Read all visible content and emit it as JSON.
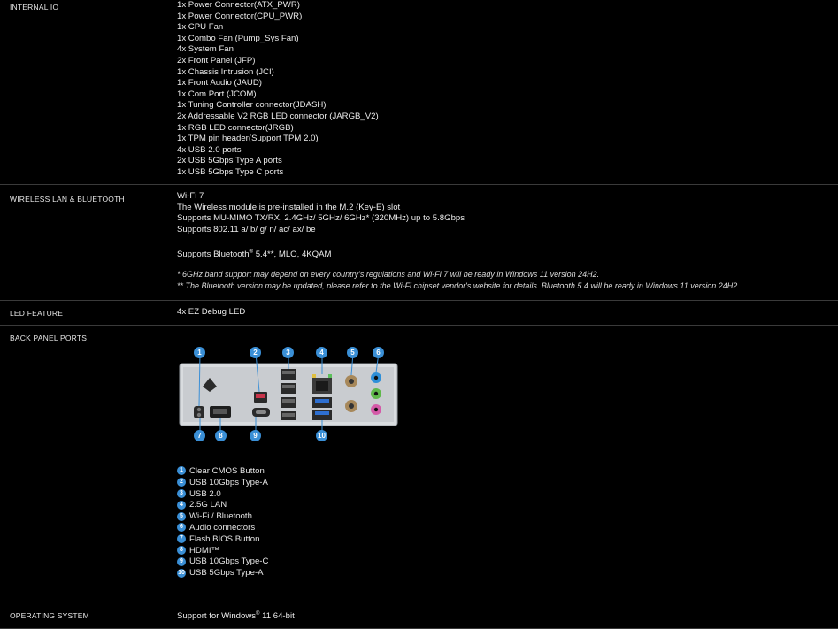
{
  "internal_io": {
    "label": "INTERNAL IO",
    "items": [
      "1x Power Connector(ATX_PWR)",
      "1x Power Connector(CPU_PWR)",
      "1x CPU Fan",
      "1x Combo Fan (Pump_Sys Fan)",
      "4x System Fan",
      "2x Front Panel (JFP)",
      "1x Chassis Intrusion (JCI)",
      "1x Front Audio (JAUD)",
      "1x Com Port (JCOM)",
      "1x Tuning Controller connector(JDASH)",
      "2x Addressable V2 RGB LED connector (JARGB_V2)",
      "1x RGB LED connector(JRGB)",
      "1x TPM pin header(Support TPM 2.0)",
      "4x USB 2.0 ports",
      "2x USB 5Gbps Type A ports",
      "1x USB 5Gbps Type C ports"
    ]
  },
  "wireless": {
    "label": "WIRELESS LAN & BLUETOOTH",
    "lines": [
      "Wi-Fi 7",
      "The Wireless module is pre-installed in the M.2 (Key-E) slot",
      "Supports MU-MIMO TX/RX, 2.4GHz/ 5GHz/ 6GHz* (320MHz) up to 5.8Gbps",
      "Supports 802.11 a/ b/ g/ n/ ac/ ax/ be"
    ],
    "bt_prefix": "Supports Bluetooth",
    "bt_sup": "®",
    "bt_suffix": " 5.4**, MLO, 4KQAM",
    "note1": "* 6GHz band support may depend on every country's regulations and Wi-Fi 7 will be ready in Windows 11 version 24H2.",
    "note2": "** The Bluetooth version may be updated, please refer to the Wi-Fi chipset vendor's website for details. Bluetooth 5.4 will be ready in Windows 11 version 24H2."
  },
  "led": {
    "label": "LED FEATURE",
    "value": "4x EZ Debug LED"
  },
  "back_panel": {
    "label": "BACK PANEL PORTS",
    "legend": [
      {
        "num": "1",
        "text": "Clear CMOS Button"
      },
      {
        "num": "2",
        "text": "USB 10Gbps Type-A"
      },
      {
        "num": "3",
        "text": "USB 2.0"
      },
      {
        "num": "4",
        "text": "2.5G LAN"
      },
      {
        "num": "5",
        "text": "Wi-Fi / Bluetooth"
      },
      {
        "num": "6",
        "text": "Audio connectors"
      },
      {
        "num": "7",
        "text": "Flash BIOS Button"
      },
      {
        "num": "8",
        "text": "HDMI™"
      },
      {
        "num": "9",
        "text": "USB 10Gbps Type-C"
      },
      {
        "num": "10",
        "text": "USB 5Gbps Type-A"
      }
    ]
  },
  "os": {
    "label": "OPERATING SYSTEM",
    "prefix": "Support for Windows",
    "sup": "®",
    "suffix": " 11 64-bit"
  },
  "colors": {
    "background": "#000000",
    "callout": "#3a8fd6",
    "divider": "#3a3a3a"
  }
}
